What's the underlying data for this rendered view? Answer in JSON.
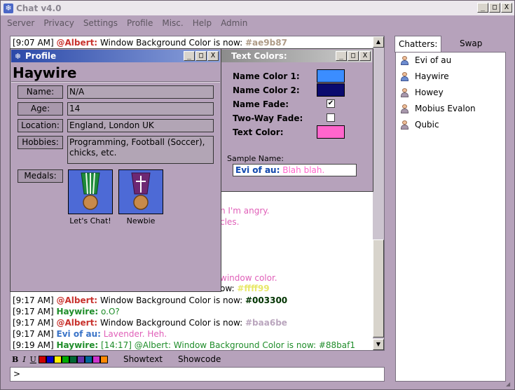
{
  "window": {
    "title": "Chat v4.0",
    "min": "_",
    "max": "□",
    "close": "X"
  },
  "menu": [
    "Server",
    "Privacy",
    "Settings",
    "Profile",
    "Misc.",
    "Help",
    "Admin"
  ],
  "chat": {
    "lines": [
      {
        "ts": "[9:07 AM]",
        "name": "@Albert:",
        "name_color": "#c8322d",
        "msg": "Window Background Color is now:",
        "msg_color": "#000000",
        "extra": "#ae9b87",
        "extra_color": "#ae9b87"
      },
      {
        "ts": "",
        "name": "",
        "name_color": "#000000",
        "msg": "n I'm angry.",
        "msg_color": "#e05fb8",
        "extra": "",
        "extra_color": "#000000"
      },
      {
        "ts": "",
        "name": "",
        "name_color": "#000000",
        "msg": "cles.",
        "msg_color": "#e05fb8",
        "extra": "",
        "extra_color": "#000000"
      },
      {
        "ts": "",
        "name": "",
        "name_color": "#000000",
        "msg": "window color.",
        "msg_color": "#e05fb8",
        "extra": "",
        "extra_color": "#000000"
      },
      {
        "ts": "",
        "name": "",
        "name_color": "#000000",
        "msg": "ow:",
        "msg_color": "#000000",
        "extra": "#ffff99",
        "extra_color": "#e8e86a"
      },
      {
        "ts": "[9:17 AM]",
        "name": "@Albert:",
        "name_color": "#c8322d",
        "msg": "Window Background Color is now:",
        "msg_color": "#000000",
        "extra": "#003300",
        "extra_color": "#003300"
      },
      {
        "ts": "[9:17 AM]",
        "name": "Haywire:",
        "name_color": "#1f8d2a",
        "msg": "o.O?",
        "msg_color": "#1f8d2a",
        "extra": "",
        "extra_color": "#000000"
      },
      {
        "ts": "[9:17 AM]",
        "name": "@Albert:",
        "name_color": "#c8322d",
        "msg": "Window Background Color is now:",
        "msg_color": "#000000",
        "extra": "#baa6be",
        "extra_color": "#baa6be"
      },
      {
        "ts": "[9:17 AM]",
        "name": "Evi of au:",
        "name_color": "#3a74c8",
        "msg": "Lavender. Heh.",
        "msg_color": "#e05fb8",
        "extra": "",
        "extra_color": "#000000"
      },
      {
        "ts": "[9:19 AM]",
        "name": "Haywire:",
        "name_color": "#1f8d2a",
        "msg": "[14:17] @Albert: Window Background Color is now: #88baf1",
        "msg_color": "#1f8d2a",
        "extra": "",
        "extra_color": "#000000"
      }
    ]
  },
  "format": {
    "bold": "B",
    "italic": "I",
    "underline": "U",
    "swatches": [
      "#cc0000",
      "#0000cc",
      "#ffee00",
      "#00aa00",
      "#006633",
      "#6633aa",
      "#006699",
      "#cc33cc",
      "#ff8800"
    ],
    "showtext": "Showtext",
    "showcode": "Showcode"
  },
  "input": {
    "value": ">"
  },
  "tabs": {
    "chatters": "Chatters:",
    "swap": "Swap Panes"
  },
  "chatters": [
    "Evi of au",
    "Haywire",
    "Howey",
    "Mobius Evalon",
    "Qubic"
  ],
  "profile": {
    "title": "Profile",
    "name": "Haywire",
    "fields": [
      {
        "label": "Name:",
        "value": "N/A"
      },
      {
        "label": "Age:",
        "value": "14"
      },
      {
        "label": "Location:",
        "value": "England, London UK"
      },
      {
        "label": "Hobbies:",
        "value": "Programming, Football (Soccer), chicks, etc."
      }
    ],
    "medals_label": "Medals:",
    "medals": [
      {
        "caption": "Let's Chat!",
        "ribbon": "green"
      },
      {
        "caption": "Newbie",
        "ribbon": "purple"
      }
    ]
  },
  "text_colors": {
    "title": "Text Colors:",
    "name_color1_label": "Name Color 1:",
    "name_color1": "#3b8dff",
    "name_color2_label": "Name Color 2:",
    "name_color2": "#0a0a6e",
    "name_fade_label": "Name Fade:",
    "name_fade_checked": "✔",
    "two_way_label": "Two-Way Fade:",
    "text_color_label": "Text Color:",
    "text_color": "#ff66cc",
    "sample_label": "Sample Name:",
    "sample_name": "Evi of au:",
    "sample_text": "Blah blah."
  }
}
